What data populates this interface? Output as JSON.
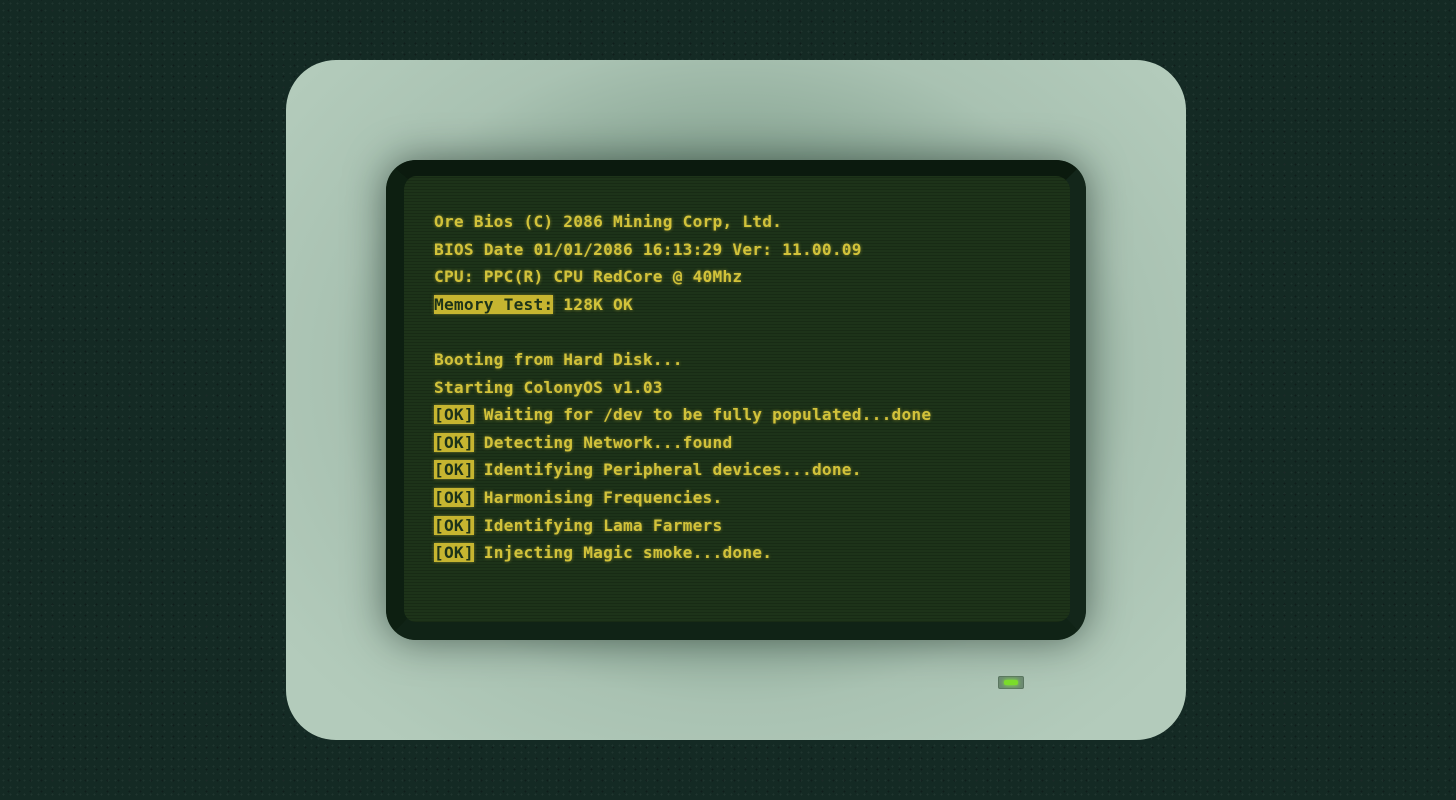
{
  "terminal": {
    "header_lines": [
      "Ore Bios (C) 2086 Mining Corp, Ltd.",
      "BIOS Date 01/01/2086 16:13:29 Ver: 11.00.09",
      "CPU: PPC(R) CPU RedCore @ 40Mhz"
    ],
    "memory_test": {
      "label": "Memory Test:",
      "value": " 128K OK"
    },
    "boot_lines": [
      "Booting from Hard Disk...",
      "Starting ColonyOS v1.03"
    ],
    "status_tag": "[OK]",
    "status_lines": [
      " Waiting for /dev to be fully populated...done",
      " Detecting Network...found",
      " Identifying Peripheral devices...done.",
      " Harmonising Frequencies.",
      " Identifying Lama Farmers",
      " Injecting Magic smoke...done."
    ]
  },
  "power_led": {
    "state": "on",
    "color": "#7bdc2a"
  },
  "colors": {
    "text": "#d2c23a",
    "screen": "#1d3319",
    "background": "#142a24",
    "monitor_shell": "#b3cbbb"
  }
}
